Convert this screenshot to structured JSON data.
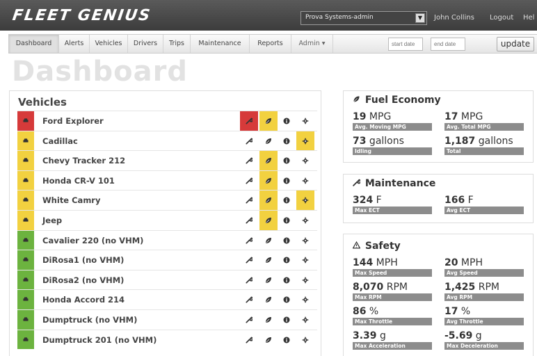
{
  "app": {
    "logo": "FLEET GENIUS",
    "account": "Prova Systems-admin",
    "user": "John Collins",
    "logout": "Logout",
    "help": "Hel"
  },
  "nav": {
    "items": [
      "Dashboard",
      "Alerts",
      "Vehicles",
      "Drivers",
      "Trips",
      "Maintenance",
      "Reports",
      "Admin ▾"
    ],
    "start_placeholder": "start date",
    "end_placeholder": "end date",
    "update_label": "update"
  },
  "page_title": "Dashboard",
  "vehicles": {
    "title": "Vehicles",
    "rows": [
      {
        "name": "Ford Explorer",
        "status": "red",
        "maint_alert": "red",
        "fuel_alert": "yellow",
        "safety_alert": "none"
      },
      {
        "name": "Cadillac",
        "status": "yellow",
        "maint_alert": "none",
        "fuel_alert": "none",
        "safety_alert": "yellow"
      },
      {
        "name": "Chevy Tracker 212",
        "status": "yellow",
        "maint_alert": "none",
        "fuel_alert": "yellow",
        "safety_alert": "none"
      },
      {
        "name": "Honda CR-V 101",
        "status": "yellow",
        "maint_alert": "none",
        "fuel_alert": "yellow",
        "safety_alert": "none"
      },
      {
        "name": "White Camry",
        "status": "yellow",
        "maint_alert": "none",
        "fuel_alert": "yellow",
        "safety_alert": "yellow"
      },
      {
        "name": "Jeep",
        "status": "yellow",
        "maint_alert": "none",
        "fuel_alert": "yellow",
        "safety_alert": "none"
      },
      {
        "name": "Cavalier 220 (no VHM)",
        "status": "green",
        "maint_alert": "none",
        "fuel_alert": "none",
        "safety_alert": "none"
      },
      {
        "name": "DiRosa1 (no VHM)",
        "status": "green",
        "maint_alert": "none",
        "fuel_alert": "none",
        "safety_alert": "none"
      },
      {
        "name": "DiRosa2 (no VHM)",
        "status": "green",
        "maint_alert": "none",
        "fuel_alert": "none",
        "safety_alert": "none"
      },
      {
        "name": "Honda Accord 214",
        "status": "green",
        "maint_alert": "none",
        "fuel_alert": "none",
        "safety_alert": "none"
      },
      {
        "name": "Dumptruck (no VHM)",
        "status": "green",
        "maint_alert": "none",
        "fuel_alert": "none",
        "safety_alert": "none"
      },
      {
        "name": "Dumptruck 201 (no VHM)",
        "status": "green",
        "maint_alert": "none",
        "fuel_alert": "none",
        "safety_alert": "none"
      }
    ]
  },
  "fuel": {
    "title": "Fuel Economy",
    "stats": [
      {
        "num": "19",
        "unit": " MPG",
        "label": "Avg. Moving MPG"
      },
      {
        "num": "17",
        "unit": " MPG",
        "label": "Avg. Total MPG"
      },
      {
        "num": "73",
        "unit": " gallons",
        "label": "Idling"
      },
      {
        "num": "1,187",
        "unit": " gallons",
        "label": "Total"
      }
    ]
  },
  "maintenance": {
    "title": "Maintenance",
    "stats": [
      {
        "num": "324",
        "unit": " F",
        "label": "Max ECT"
      },
      {
        "num": "166",
        "unit": " F",
        "label": "Avg ECT"
      }
    ]
  },
  "safety": {
    "title": "Safety",
    "stats": [
      {
        "num": "144",
        "unit": " MPH",
        "label": "Max Speed"
      },
      {
        "num": "20",
        "unit": " MPH",
        "label": "Avg Speed"
      },
      {
        "num": "8,070",
        "unit": " RPM",
        "label": "Max RPM"
      },
      {
        "num": "1,425",
        "unit": " RPM",
        "label": "Avg RPM"
      },
      {
        "num": "86",
        "unit": " %",
        "label": "Max Throttle"
      },
      {
        "num": "17",
        "unit": " %",
        "label": "Avg Throttle"
      },
      {
        "num": "3.39",
        "unit": " g",
        "label": "Max Acceleration"
      },
      {
        "num": "-5.69",
        "unit": " g",
        "label": "Max Deceleration"
      }
    ]
  },
  "colors": {
    "red": "#d63a3a",
    "yellow": "#f2d140",
    "green": "#6cb33f",
    "label_gray": "#8c8c8c"
  }
}
